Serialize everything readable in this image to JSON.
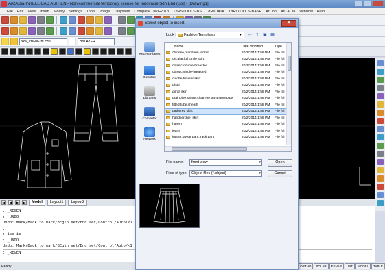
{
  "app": {
    "title": "ArCADia-INTELLICAD ASIT EN - Non-commercial temporary license for Innovacie Sdn Bhd (Sol) - [Drawing1]",
    "menu": [
      "File",
      "Edit",
      "View",
      "Insert",
      "Modify",
      "Settings",
      "Tools",
      "Image",
      "Trillystem",
      "Compatie.DWG2013",
      "TdRSTOOLS-BS",
      "TdRsDATA",
      "TdRsTOOLS-BASE",
      "ArCon",
      "ArCADia",
      "Window",
      "Help"
    ],
    "layer_combo": "xxa_VBF0628C550",
    "bylayer_combo": "BYLAYER"
  },
  "layout_tabs": {
    "nav": [
      "|◀",
      "◀",
      "▶",
      "▶|"
    ],
    "tabs": [
      "Model",
      "Layout1",
      "Layout2"
    ]
  },
  "command_lines": [
    ": _REGEN",
    ": _UNDO",
    "Undo:  Mark/Back to mark/BEgin set/End set/Control/Auto/<1",
    ":",
    ": iss_ic",
    ": _UNDO",
    "Undo:  Mark/Back to mark/BEgin set/End set/Control/Auto/<1",
    ": _REGEN"
  ],
  "status": {
    "ready": "Ready",
    "buttons": [
      "SNAP",
      "GRID",
      "ORTHO",
      "POLAR",
      "ESNAP",
      "LWT",
      "MODEL",
      "TABLE"
    ]
  },
  "dialog": {
    "title": "Select object to insert",
    "close_label": "X",
    "look_in_label": "Look in:",
    "look_in_value": "Fashion Templates",
    "places": [
      "Recent Places",
      "Desktop",
      "Libraries",
      "Computer",
      "Network"
    ],
    "columns": [
      "Name",
      "Date modified",
      "Type"
    ],
    "files": [
      {
        "name": "chinese,mandarin jacket",
        "date": "20/2/2014 1:58 PM",
        "type": "File fol"
      },
      {
        "name": "circular,full circle skirt",
        "date": "20/2/2014 1:58 PM",
        "type": "File fol"
      },
      {
        "name": "classic double-breasted",
        "date": "20/2/2014 1:58 PM",
        "type": "File fol"
      },
      {
        "name": "classic single-breasted",
        "date": "20/2/2014 1:58 PM",
        "type": "File fol"
      },
      {
        "name": "culotte,trouser skirt",
        "date": "20/2/2014 1:58 PM",
        "type": "File fol"
      },
      {
        "name": "dhoti",
        "date": "20/2/2014 1:58 PM",
        "type": "File fol"
      },
      {
        "name": "dimdl skirt",
        "date": "20/2/2014 1:58 PM",
        "type": "File fol"
      },
      {
        "name": "drainpipe,skinny,cigarette pant,stovepipe",
        "date": "20/2/2014 1:58 PM",
        "type": "File fol"
      },
      {
        "name": "fitted,tube,sheath",
        "date": "20/2/2014 1:58 PM",
        "type": "File fol"
      },
      {
        "name": "gathered skirt",
        "date": "20/2/2014 1:58 PM",
        "type": "File fol"
      },
      {
        "name": "handkerchief skirt",
        "date": "20/2/2014 1:58 PM",
        "type": "File fol"
      },
      {
        "name": "harem",
        "date": "20/2/2014 1:58 PM",
        "type": "File fol"
      },
      {
        "name": "jeans",
        "date": "20/2/2014 1:58 PM",
        "type": "File fol"
      },
      {
        "name": "jogger,sweat pant,track pant",
        "date": "20/2/2014 1:58 PM",
        "type": "File fol"
      }
    ],
    "file_name_label": "File name:",
    "file_name_value": "front view",
    "file_type_label": "Files of type:",
    "file_type_value": "Object files (*.object)",
    "open_label": "Open",
    "cancel_label": "Cancel"
  }
}
